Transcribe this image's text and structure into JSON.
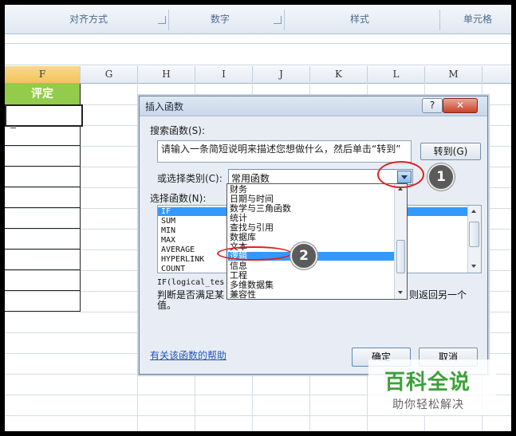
{
  "ribbon": {
    "groups": [
      "对齐方式",
      "数字",
      "样式",
      "单元格"
    ]
  },
  "sheet": {
    "columns": [
      "F",
      "G",
      "H",
      "I",
      "J",
      "K",
      "L",
      "M"
    ],
    "f_header": "评定",
    "f_first_cell": "="
  },
  "dialog": {
    "title": "插入函数",
    "help_button": "?",
    "close_button": "✕",
    "search_label": "搜索函数(S):",
    "search_text": "请输入一条简短说明来描述您想做什么，然后单击“转到”",
    "goto_button": "转到(G)",
    "category_label": "或选择类别(C):",
    "category_value": "常用函数",
    "select_function_label": "选择函数(N):",
    "functions": [
      "IF",
      "SUM",
      "MIN",
      "MAX",
      "AVERAGE",
      "HYPERLINK",
      "COUNT"
    ],
    "syntax": "IF(logical_tes",
    "description_left": "判断是否满足某",
    "description_right": "则返回另一个",
    "description_line2": "值。",
    "help_link": "有关该函数的帮助",
    "ok_button": "确定",
    "cancel_button": "取消"
  },
  "dropdown": {
    "items": [
      "财务",
      "日期与时间",
      "数学与三角函数",
      "统计",
      "查找与引用",
      "数据库",
      "文本",
      "逻辑",
      "信息",
      "工程",
      "多维数据集",
      "兼容性"
    ],
    "selected": "逻辑"
  },
  "callouts": {
    "step1": "1",
    "step2": "2"
  },
  "watermark": {
    "title": "百科全说",
    "subtitle": "助你轻松解决"
  }
}
